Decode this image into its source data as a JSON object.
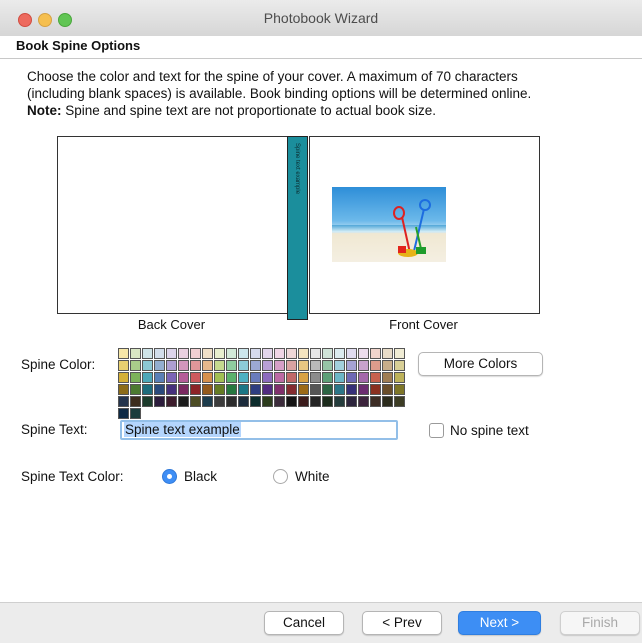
{
  "window": {
    "title": "Photobook Wizard"
  },
  "section": {
    "title": "Book Spine Options"
  },
  "description": {
    "line1": "Choose the color and text for the spine of your cover. A maximum of 70 characters",
    "line2": "(including blank spaces) is available. Book binding options will be determined online.",
    "note_label": "Note:",
    "note_text": " Spine and spine text are not proportionate to actual book size."
  },
  "preview": {
    "back_cover_label": "Back Cover",
    "front_cover_label": "Front Cover",
    "spine_text": "Spine text example",
    "spine_color": "#1b8e9c"
  },
  "spine_color": {
    "label": "Spine Color:",
    "more_colors_label": "More Colors",
    "swatches": [
      "#f6e7a8",
      "#d9e6c4",
      "#cfe4e8",
      "#d2ddea",
      "#dcd4ea",
      "#ead0e0",
      "#f2d0d3",
      "#f0e0c8",
      "#e8efcf",
      "#d3e9d9",
      "#cde6ec",
      "#d6daec",
      "#e3d6ec",
      "#f0d6e6",
      "#efd8d8",
      "#f4e4c0",
      "#e6e6e6",
      "#d0e4d8",
      "#dcecf0",
      "#e0dcf0",
      "#ecdcec",
      "#f0d4cc",
      "#e8dcc8",
      "#f0ecd4",
      "#e8d070",
      "#a9cc8a",
      "#8cc8d4",
      "#93aed0",
      "#ad9ed2",
      "#d296bc",
      "#e1979a",
      "#e6b88c",
      "#c5d98f",
      "#8fcc9f",
      "#8ccbd8",
      "#9ca8d4",
      "#b89fd6",
      "#d59fc8",
      "#d9a2a2",
      "#e8c682",
      "#b9b9b9",
      "#96c4a6",
      "#a2d0dc",
      "#a6a2d4",
      "#c8a2cc",
      "#dd9c8c",
      "#c8ae8a",
      "#d8cf96",
      "#d4b038",
      "#7cb25a",
      "#4ea7b8",
      "#5a7fb6",
      "#7b63b6",
      "#b55c98",
      "#cd5a5e",
      "#d5904c",
      "#a2bf54",
      "#5bb06c",
      "#4db0c2",
      "#6a7cbc",
      "#8c6cbc",
      "#bb6aa4",
      "#c06868",
      "#d8a246",
      "#8c8c8c",
      "#5ea078",
      "#6cb6c6",
      "#6e68b4",
      "#a468aa",
      "#c7624e",
      "#a07e54",
      "#bdb25a",
      "#8c6c18",
      "#4c7a30",
      "#1e6c7c",
      "#2a4a7c",
      "#46307c",
      "#7a2860",
      "#8c2428",
      "#945a1c",
      "#667c24",
      "#267840",
      "#1a7686",
      "#2e3e80",
      "#522c80",
      "#80306c",
      "#842c30",
      "#9c6a18",
      "#555555",
      "#2c6444",
      "#2c7688",
      "#363078",
      "#6c2c70",
      "#8a3020",
      "#6a4e2a",
      "#7e7628",
      "#24344c",
      "#3c2c1c",
      "#1c3c2c",
      "#2c1c3c",
      "#3c1c2c",
      "#1c1c1c",
      "#4c4c24",
      "#1c3c4c",
      "#3c3c3c",
      "#2c2c2c",
      "#1c2c3c",
      "#0c2c2c",
      "#2c3c1c",
      "#3c2c3c",
      "#141414",
      "#3c1c1c",
      "#242424",
      "#1c2c1c",
      "#243c3c",
      "#2c243c",
      "#3c243c",
      "#3c2c24",
      "#2c2c1c",
      "#3c3c24",
      "#0f2a44",
      "#1b3c3c"
    ]
  },
  "spine_text": {
    "label": "Spine Text:",
    "value": "Spine text example",
    "no_spine_text_label": "No spine text"
  },
  "spine_text_color": {
    "label": "Spine Text Color:",
    "options": [
      "Black",
      "White"
    ],
    "selected": "Black"
  },
  "footer": {
    "cancel_label": "Cancel",
    "prev_label": "< Prev",
    "next_label": "Next >",
    "finish_label": "Finish"
  }
}
